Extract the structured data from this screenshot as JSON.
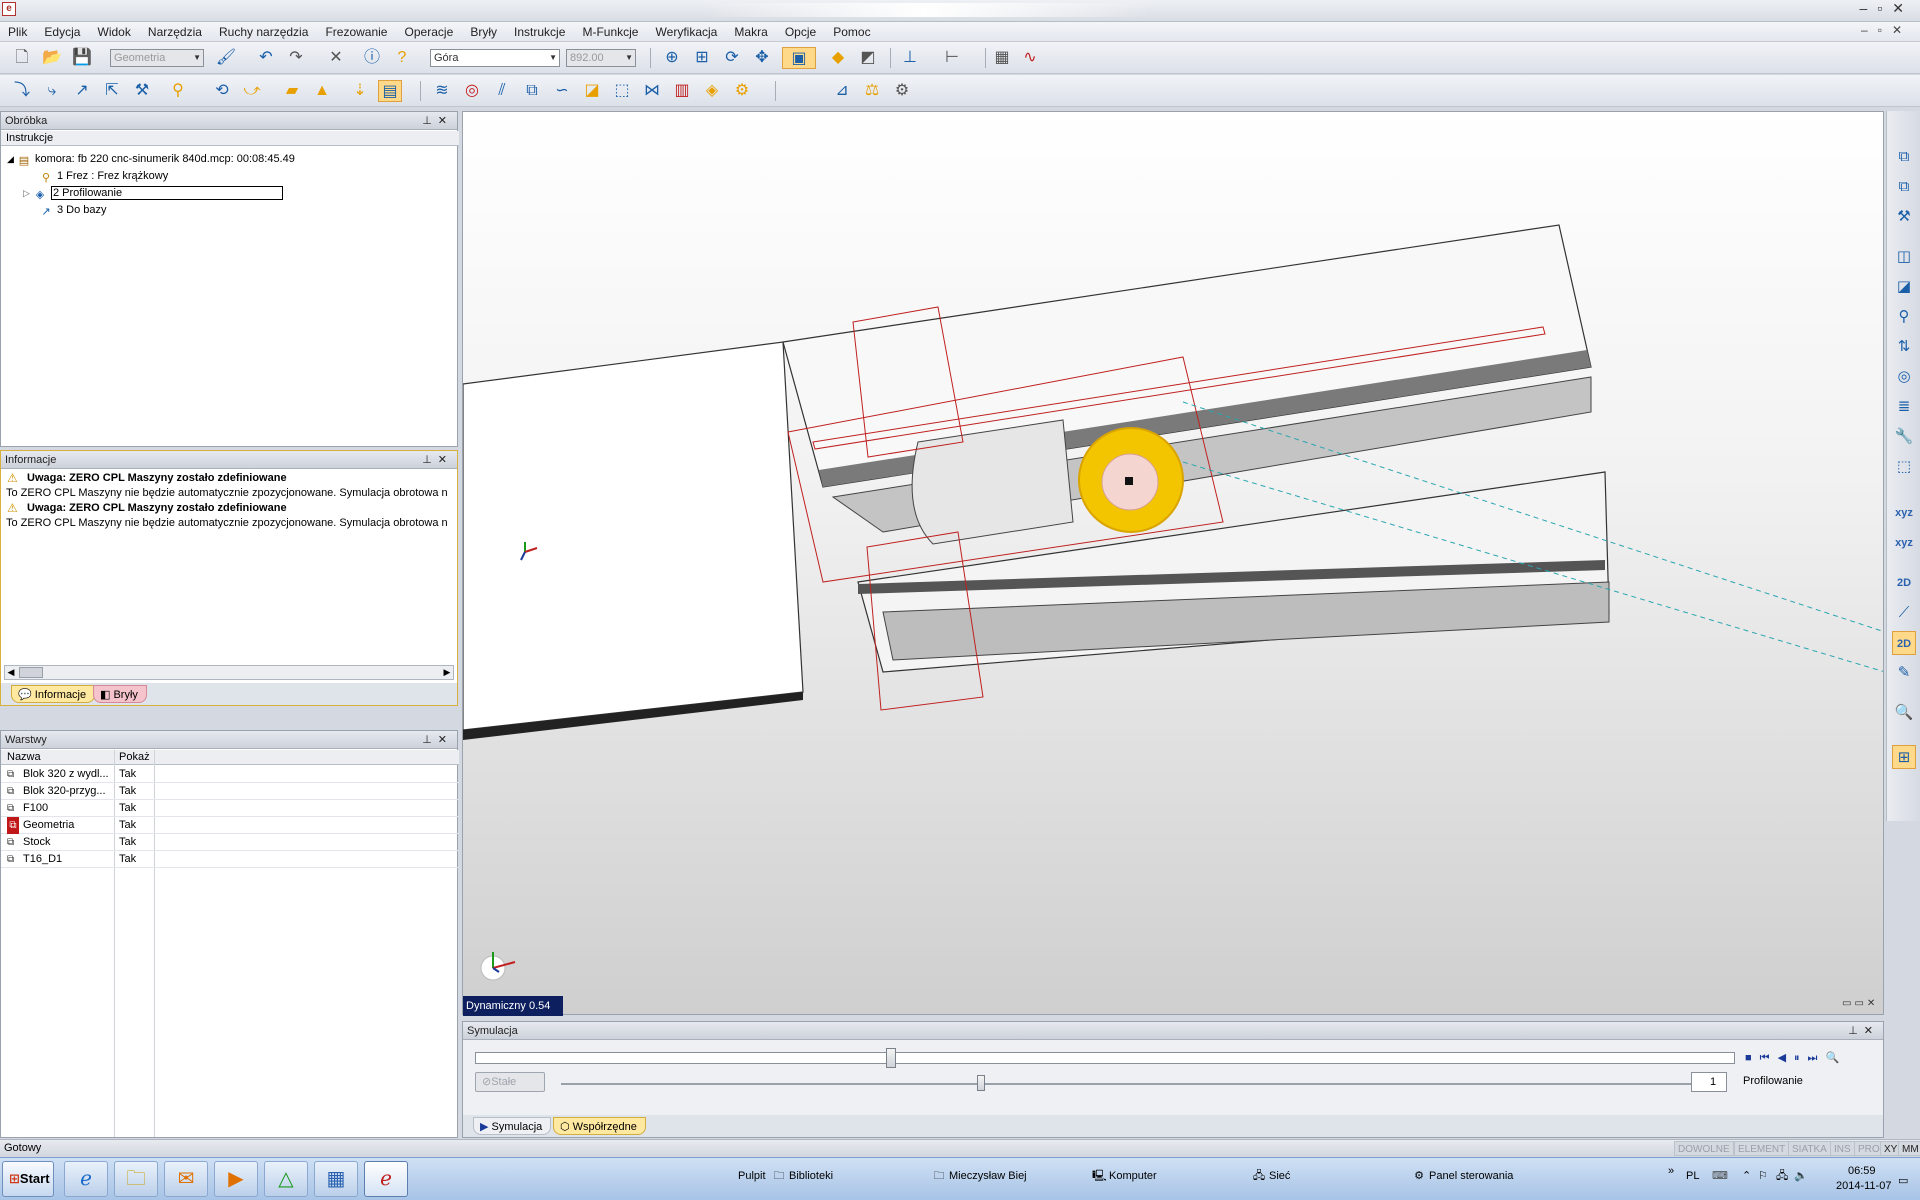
{
  "menu": [
    "Plik",
    "Edycja",
    "Widok",
    "Narzędzia",
    "Ruchy narzędzia",
    "Frezowanie",
    "Operacje",
    "Bryły",
    "Instrukcje",
    "M-Funkcje",
    "Weryfikacja",
    "Makra",
    "Opcje",
    "Pomoc"
  ],
  "toolbar": {
    "layer_combo": "Geometria",
    "view_combo": "Góra",
    "height_combo": "892.00"
  },
  "obrobka": {
    "title": "Obróbka",
    "column": "Instrukcje",
    "root": "komora: fb 220 cnc-sinumerik 840d.mcp: 00:08:45.49",
    "items": [
      "1 Frez : Frez krążkowy",
      "2 Profilowanie",
      "3 Do bazy"
    ]
  },
  "info": {
    "title": "Informacje",
    "messages": [
      {
        "head": "Uwaga: ZERO CPL Maszyny zostało zdefiniowane",
        "body": "To ZERO CPL Maszyny nie będzie automatycznie zpozycjonowane. Symulacja obrotowa n"
      },
      {
        "head": "Uwaga: ZERO CPL Maszyny zostało zdefiniowane",
        "body": "To ZERO CPL Maszyny nie będzie automatycznie zpozycjonowane. Symulacja obrotowa n"
      }
    ],
    "tabs": [
      "Informacje",
      "Bryły"
    ]
  },
  "warstwy": {
    "title": "Warstwy",
    "col_name": "Nazwa",
    "col_show": "Pokaż",
    "rows": [
      {
        "name": "Blok 320 z wydl...",
        "show": "Tak"
      },
      {
        "name": "Blok 320-przyg...",
        "show": "Tak"
      },
      {
        "name": "F100",
        "show": "Tak"
      },
      {
        "name": "Geometria",
        "show": "Tak"
      },
      {
        "name": "Stock",
        "show": "Tak"
      },
      {
        "name": "T16_D1",
        "show": "Tak"
      }
    ]
  },
  "viewport": {
    "mode_label": "Dynamiczny 0.54"
  },
  "right_toolbar": {
    "xyz1": "xyz",
    "xyz2": "xyz",
    "twoD1": "2D",
    "twoD2": "2D"
  },
  "simulation": {
    "title": "Symulacja",
    "stale_label": "Stałe",
    "speed_value": "1",
    "operation": "Profilowanie",
    "progress": 0.33,
    "tabs": [
      "Symulacja",
      "Współrzędne"
    ]
  },
  "status": {
    "text": "Gotowy",
    "indicators": [
      "DOWOLNE",
      "ELEMENT",
      "SIATKA",
      "INS",
      "PRO",
      "XY",
      "MM"
    ]
  },
  "taskbar": {
    "start": "Start",
    "desktop": "Pulpit",
    "links": [
      "Biblioteki",
      "Mieczysław Biej",
      "Komputer",
      "Sieć",
      "Panel sterowania"
    ],
    "lang": "PL",
    "time": "06:59",
    "date": "2014-11-07"
  },
  "colors": {
    "accent_orange": "#e8a000",
    "tool_yellow": "#f2c500",
    "toolpath_red": "#c02020",
    "dyn_label_bg": "#0d1f5e"
  }
}
